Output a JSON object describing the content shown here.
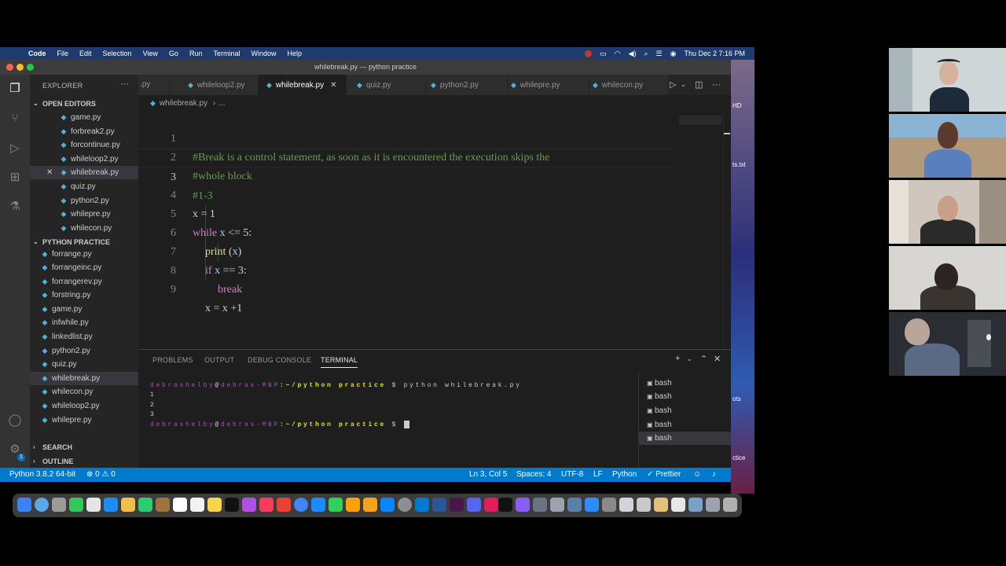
{
  "menubar": {
    "app_name": "Code",
    "items": [
      "File",
      "Edit",
      "Selection",
      "View",
      "Go",
      "Run",
      "Terminal",
      "Window",
      "Help"
    ],
    "clock": "Thu Dec 2  7:16 PM"
  },
  "window": {
    "title": "whilebreak.py — python practice"
  },
  "sidebar": {
    "title": "EXPLORER",
    "open_editors_label": "OPEN EDITORS",
    "open_editors": [
      "game.py",
      "forbreak2.py",
      "forcontinue.py",
      "whileloop2.py",
      "whilebreak.py",
      "quiz.py",
      "python2.py",
      "whilepre.py",
      "whilecon.py"
    ],
    "project_label": "PYTHON PRACTICE",
    "project_files": [
      "forrange.py",
      "forrangeinc.py",
      "forrangerev.py",
      "forstring.py",
      "game.py",
      "infwhile.py",
      "linkedlist.py",
      "python2.py",
      "quiz.py",
      "whilebreak.py",
      "whilecon.py",
      "whileloop2.py",
      "whilepre.py"
    ],
    "search_label": "SEARCH",
    "outline_label": "OUTLINE",
    "badge": "1"
  },
  "tabs": [
    ".py",
    "whileloop2.py",
    "whilebreak.py",
    "quiz.py",
    "python2.py",
    "whilepre.py",
    "whilecon.py"
  ],
  "breadcrumb": {
    "file": "whilebreak.py",
    "rest": "..."
  },
  "editor": {
    "line_numbers": [
      "1",
      "2",
      "3",
      "4",
      "5",
      "6",
      "7",
      "8",
      "9"
    ],
    "lines": {
      "l1": "#Break is a control statement, as soon as it is encountered the execution skips the",
      "l2": "#whole block",
      "l3": "#1-3",
      "l4_var": "x",
      "l4_rest": " = 1",
      "l5_kw": "while",
      "l5_var": "x",
      "l5_rest": " <= 5:",
      "l6_fn": "print",
      "l6_open": " (",
      "l6_var": "x",
      "l6_close": ")",
      "l7_kw": "if",
      "l7_var": "x",
      "l7_rest": " == 3:",
      "l8_kw": "break",
      "l9_var": "x",
      "l9_eq": " = ",
      "l9_var2": "x",
      "l9_rest": " +1"
    }
  },
  "panel": {
    "tabs": [
      "PROBLEMS",
      "OUTPUT",
      "DEBUG CONSOLE",
      "TERMINAL"
    ],
    "terminal": {
      "user": "debrashelby",
      "at": "@",
      "host": "debras-MBP",
      "path": ":~/python practice",
      "prompt": " $ ",
      "command": "python whilebreak.py",
      "output": [
        "1",
        "2",
        "3"
      ]
    },
    "shells": [
      "bash",
      "bash",
      "bash",
      "bash",
      "bash"
    ]
  },
  "status": {
    "interpreter": "Python 3.8.2 64-bit",
    "errors": "⊗ 0 ⚠ 0",
    "position": "Ln 3, Col 5",
    "spaces": "Spaces: 4",
    "encoding": "UTF-8",
    "eol": "LF",
    "language": "Python",
    "prettier": "✓ Prettier"
  },
  "background": {
    "label_hd": "HD",
    "label_txt": "ts.txt",
    "label_ots": "ots",
    "label_ctice": "ctice"
  },
  "colors": {
    "accent": "#007acc",
    "comment": "#6a9955",
    "keyword": "#c586c0",
    "variable": "#9cdcfe",
    "terminal_path": "#e5e510",
    "terminal_user": "#b148c6"
  }
}
